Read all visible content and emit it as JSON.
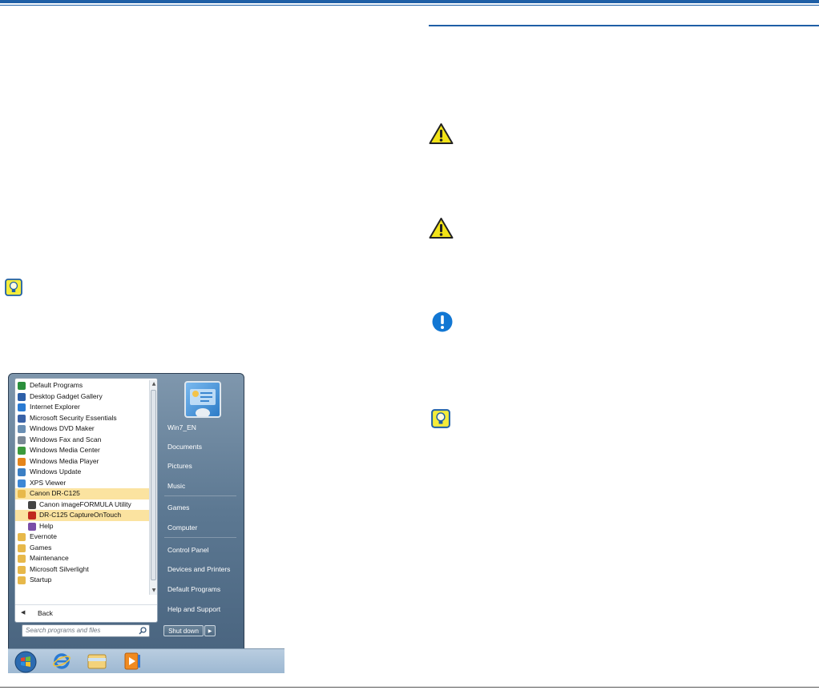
{
  "start_menu": {
    "programs": [
      {
        "label": "Default Programs",
        "icon": "default-programs-icon",
        "color": "#2b8f3c"
      },
      {
        "label": "Desktop Gadget Gallery",
        "icon": "gadget-gallery-icon",
        "color": "#2d5fa8"
      },
      {
        "label": "Internet Explorer",
        "icon": "internet-explorer-icon",
        "color": "#2a7ad2"
      },
      {
        "label": "Microsoft Security Essentials",
        "icon": "security-essentials-icon",
        "color": "#3a62a7"
      },
      {
        "label": "Windows DVD Maker",
        "icon": "dvd-maker-icon",
        "color": "#6a8fb4"
      },
      {
        "label": "Windows Fax and Scan",
        "icon": "fax-scan-icon",
        "color": "#7a8896"
      },
      {
        "label": "Windows Media Center",
        "icon": "media-center-icon",
        "color": "#3c9a3c"
      },
      {
        "label": "Windows Media Player",
        "icon": "media-player-icon",
        "color": "#e5851b"
      },
      {
        "label": "Windows Update",
        "icon": "windows-update-icon",
        "color": "#3b7fc4"
      },
      {
        "label": "XPS Viewer",
        "icon": "xps-viewer-icon",
        "color": "#3d87d6"
      },
      {
        "label": "Canon DR-C125",
        "icon": "folder-icon",
        "color": "#e7b84a",
        "highlight": true
      },
      {
        "label": "Canon imageFORMULA Utility",
        "icon": "utility-icon",
        "color": "#444444",
        "sub": true
      },
      {
        "label": "DR-C125 CaptureOnTouch",
        "icon": "captureontouch-icon",
        "color": "#c0281e",
        "sub": true,
        "highlight": true
      },
      {
        "label": "Help",
        "icon": "help-icon",
        "color": "#7a4da8",
        "sub": true
      },
      {
        "label": "Evernote",
        "icon": "folder-icon",
        "color": "#e7b84a"
      },
      {
        "label": "Games",
        "icon": "folder-icon",
        "color": "#e7b84a"
      },
      {
        "label": "Maintenance",
        "icon": "folder-icon",
        "color": "#e7b84a"
      },
      {
        "label": "Microsoft Silverlight",
        "icon": "folder-icon",
        "color": "#e7b84a"
      },
      {
        "label": "Startup",
        "icon": "folder-icon",
        "color": "#e7b84a"
      }
    ],
    "back_label": "Back",
    "search_placeholder": "Search programs and files",
    "right_items": [
      {
        "label": "Win7_EN"
      },
      {
        "label": "Documents"
      },
      {
        "label": "Pictures"
      },
      {
        "label": "Music"
      },
      {
        "label": "Games"
      },
      {
        "label": "Computer"
      },
      {
        "label": "Control Panel"
      },
      {
        "label": "Devices and Printers"
      },
      {
        "label": "Default Programs"
      },
      {
        "label": "Help and Support"
      }
    ],
    "shutdown_label": "Shut down"
  },
  "taskbar": {
    "buttons": [
      "start-orb-icon",
      "internet-explorer-icon",
      "file-explorer-icon",
      "media-player-icon"
    ]
  },
  "colors": {
    "rule": "#1f5fa6",
    "caution": "#f2e318",
    "important": "#1277d3",
    "hint": "#f5ec3a"
  }
}
